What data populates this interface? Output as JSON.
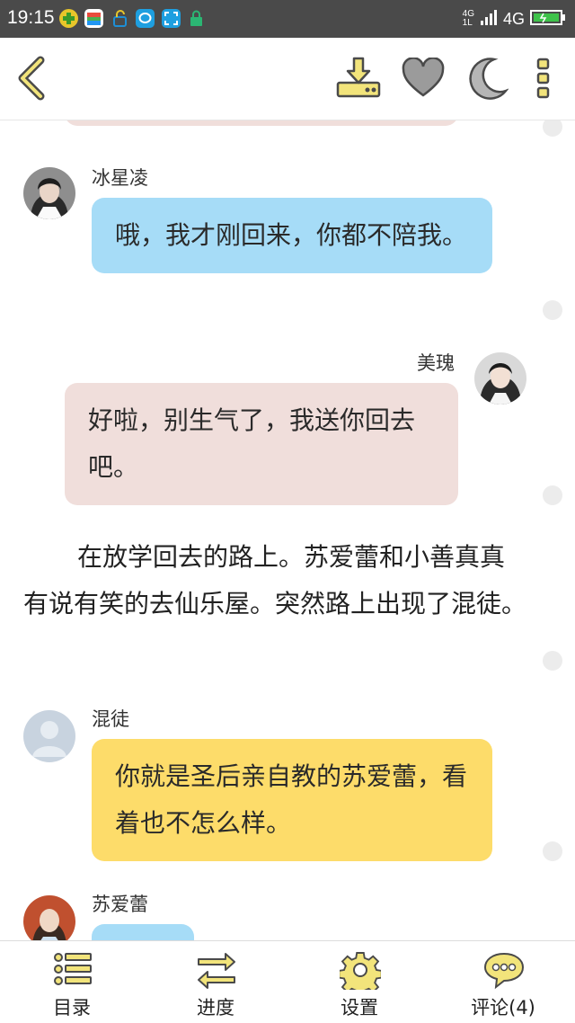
{
  "status_bar": {
    "time": "19:15",
    "network_small_top": "4G",
    "network_small_bottom": "1L",
    "network": "4G",
    "icons": [
      "plus-app-icon",
      "colorful-app-icon",
      "lock-app-icon",
      "chat-app-icon",
      "scan-app-icon",
      "lock-icon",
      "signal-icon",
      "battery-icon"
    ]
  },
  "toolbar": {
    "icons": [
      "back-icon",
      "download-icon",
      "heart-icon",
      "moon-icon",
      "more-icon"
    ],
    "accent": "#f2e47b"
  },
  "messages": [
    {
      "type": "partial",
      "color": "pink"
    },
    {
      "type": "chat",
      "side": "left",
      "speaker": "冰星凌",
      "text": "哦，我才刚回来，你都不陪我。",
      "color": "#a6dcf7"
    },
    {
      "type": "chat",
      "side": "right",
      "speaker": "美瑰",
      "text": "好啦，别生气了，我送你回去吧。",
      "color": "#f0dedb"
    },
    {
      "type": "narration",
      "text": "在放学回去的路上。苏爱蕾和小善真真有说有笑的去仙乐屋。突然路上出现了混徒。"
    },
    {
      "type": "chat",
      "side": "left",
      "speaker": "混徒",
      "text": "你就是圣后亲自教的苏爱蕾，看着也不怎么样。",
      "color": "#fddc6a"
    },
    {
      "type": "chat",
      "side": "left",
      "speaker": "苏爱蕾",
      "text": "",
      "color": "#a6dcf7"
    }
  ],
  "bottom_nav": [
    {
      "label": "目录",
      "icon": "list-icon"
    },
    {
      "label": "进度",
      "icon": "swap-arrows-icon"
    },
    {
      "label": "设置",
      "icon": "gear-icon"
    },
    {
      "label": "评论(4)",
      "icon": "comment-icon"
    }
  ]
}
